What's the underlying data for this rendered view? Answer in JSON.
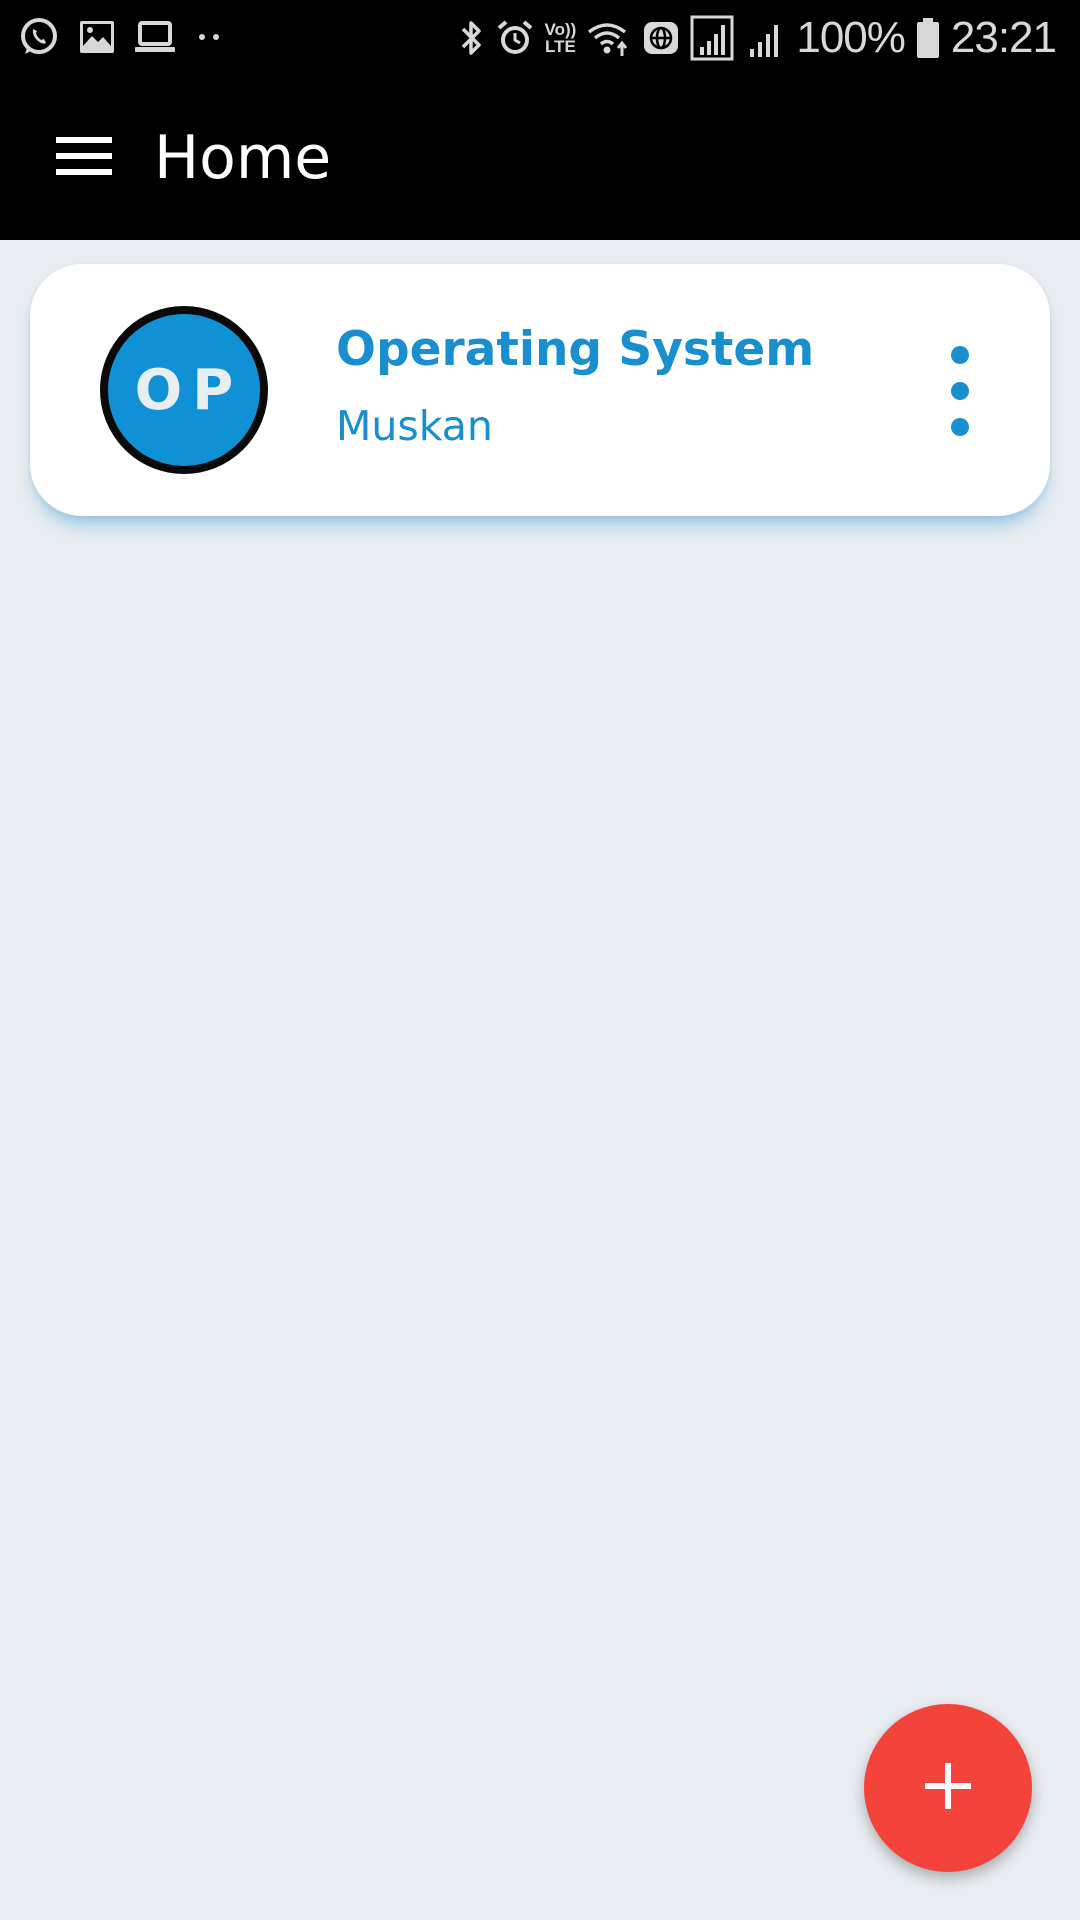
{
  "status_bar": {
    "left_icons": [
      "whatsapp-icon",
      "gallery-icon",
      "laptop-icon",
      "more-notifications-icon"
    ],
    "right_icons": [
      "bluetooth-icon",
      "alarm-icon",
      "volte-icon",
      "wifi-icon",
      "globe-icon",
      "signal-sim1-icon",
      "signal-sim2-icon",
      "battery-icon"
    ],
    "volte_line1": "Vo))",
    "volte_line2": "LTE",
    "battery_level": "100%",
    "time": "23:21"
  },
  "app_bar": {
    "title": "Home",
    "menu_icon": "hamburger-menu-icon",
    "background": "#000000"
  },
  "classes": [
    {
      "avatar_text": "OP",
      "title": "Operating System",
      "subtitle": "Muskan",
      "menu_icon": "more-vert-icon"
    }
  ],
  "fab": {
    "icon": "plus-icon",
    "color": "#f4433a"
  },
  "colors": {
    "accent": "#1a8fd0",
    "avatar_bg": "#1091d6",
    "page_bg": "#e9edf1"
  }
}
